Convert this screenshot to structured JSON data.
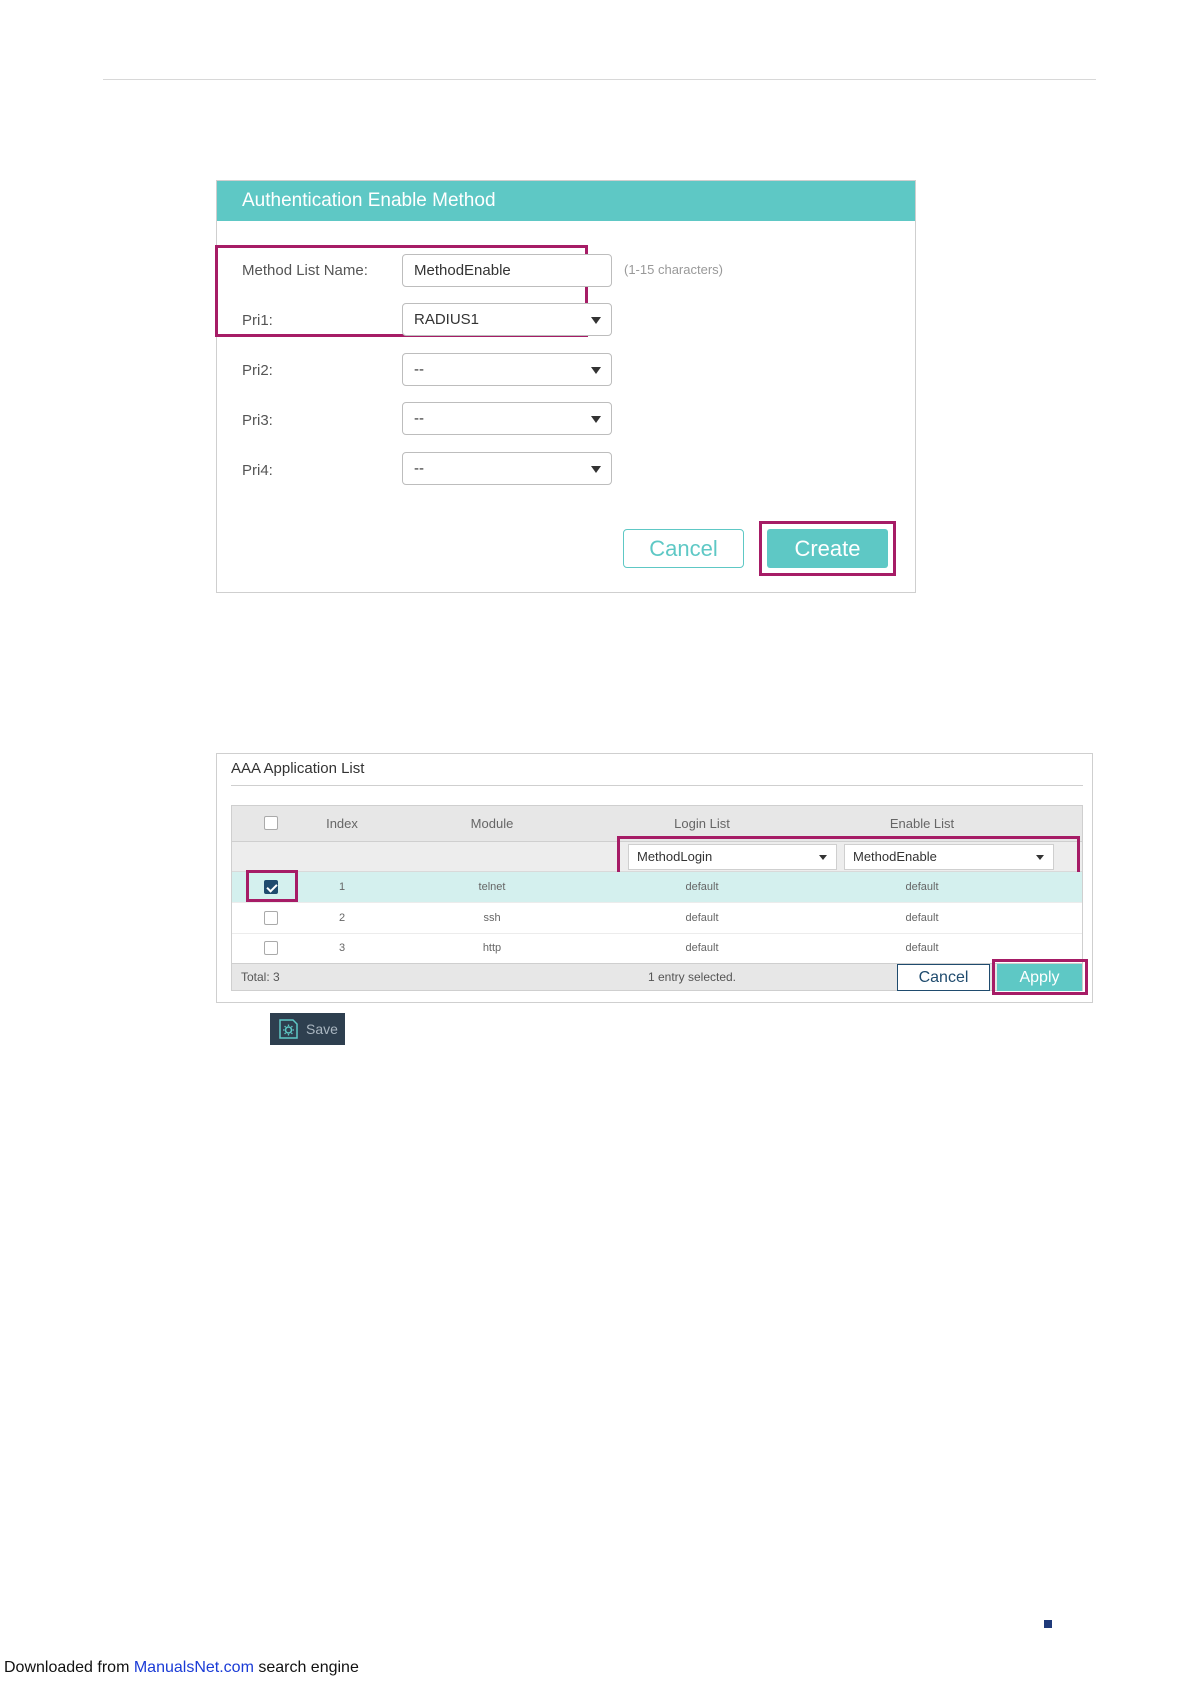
{
  "auth_panel": {
    "title": "Authentication Enable Method",
    "method_list_name": {
      "label": "Method List Name:",
      "value": "MethodEnable",
      "hint": "(1-15 characters)"
    },
    "priorities": [
      {
        "label": "Pri1:",
        "value": "RADIUS1"
      },
      {
        "label": "Pri2:",
        "value": "--"
      },
      {
        "label": "Pri3:",
        "value": "--"
      },
      {
        "label": "Pri4:",
        "value": "--"
      }
    ],
    "cancel_label": "Cancel",
    "create_label": "Create"
  },
  "aaa_panel": {
    "title": "AAA Application List",
    "columns": [
      "Index",
      "Module",
      "Login List",
      "Enable List"
    ],
    "filter": {
      "login_list": "MethodLogin",
      "enable_list": "MethodEnable"
    },
    "rows": [
      {
        "index": "1",
        "module": "telnet",
        "login": "default",
        "enable": "default",
        "checked": true
      },
      {
        "index": "2",
        "module": "ssh",
        "login": "default",
        "enable": "default",
        "checked": false
      },
      {
        "index": "3",
        "module": "http",
        "login": "default",
        "enable": "default",
        "checked": false
      }
    ],
    "total": "Total: 3",
    "selected_text": "1 entry selected.",
    "cancel_label": "Cancel",
    "apply_label": "Apply"
  },
  "save_label": "Save",
  "footer": {
    "prefix": "Downloaded from ",
    "link": "ManualsNet.com",
    "suffix": " search engine"
  },
  "colors": {
    "accent": "#5ec8c5",
    "highlight": "#a61c66",
    "dark": "#1f4b6e"
  }
}
